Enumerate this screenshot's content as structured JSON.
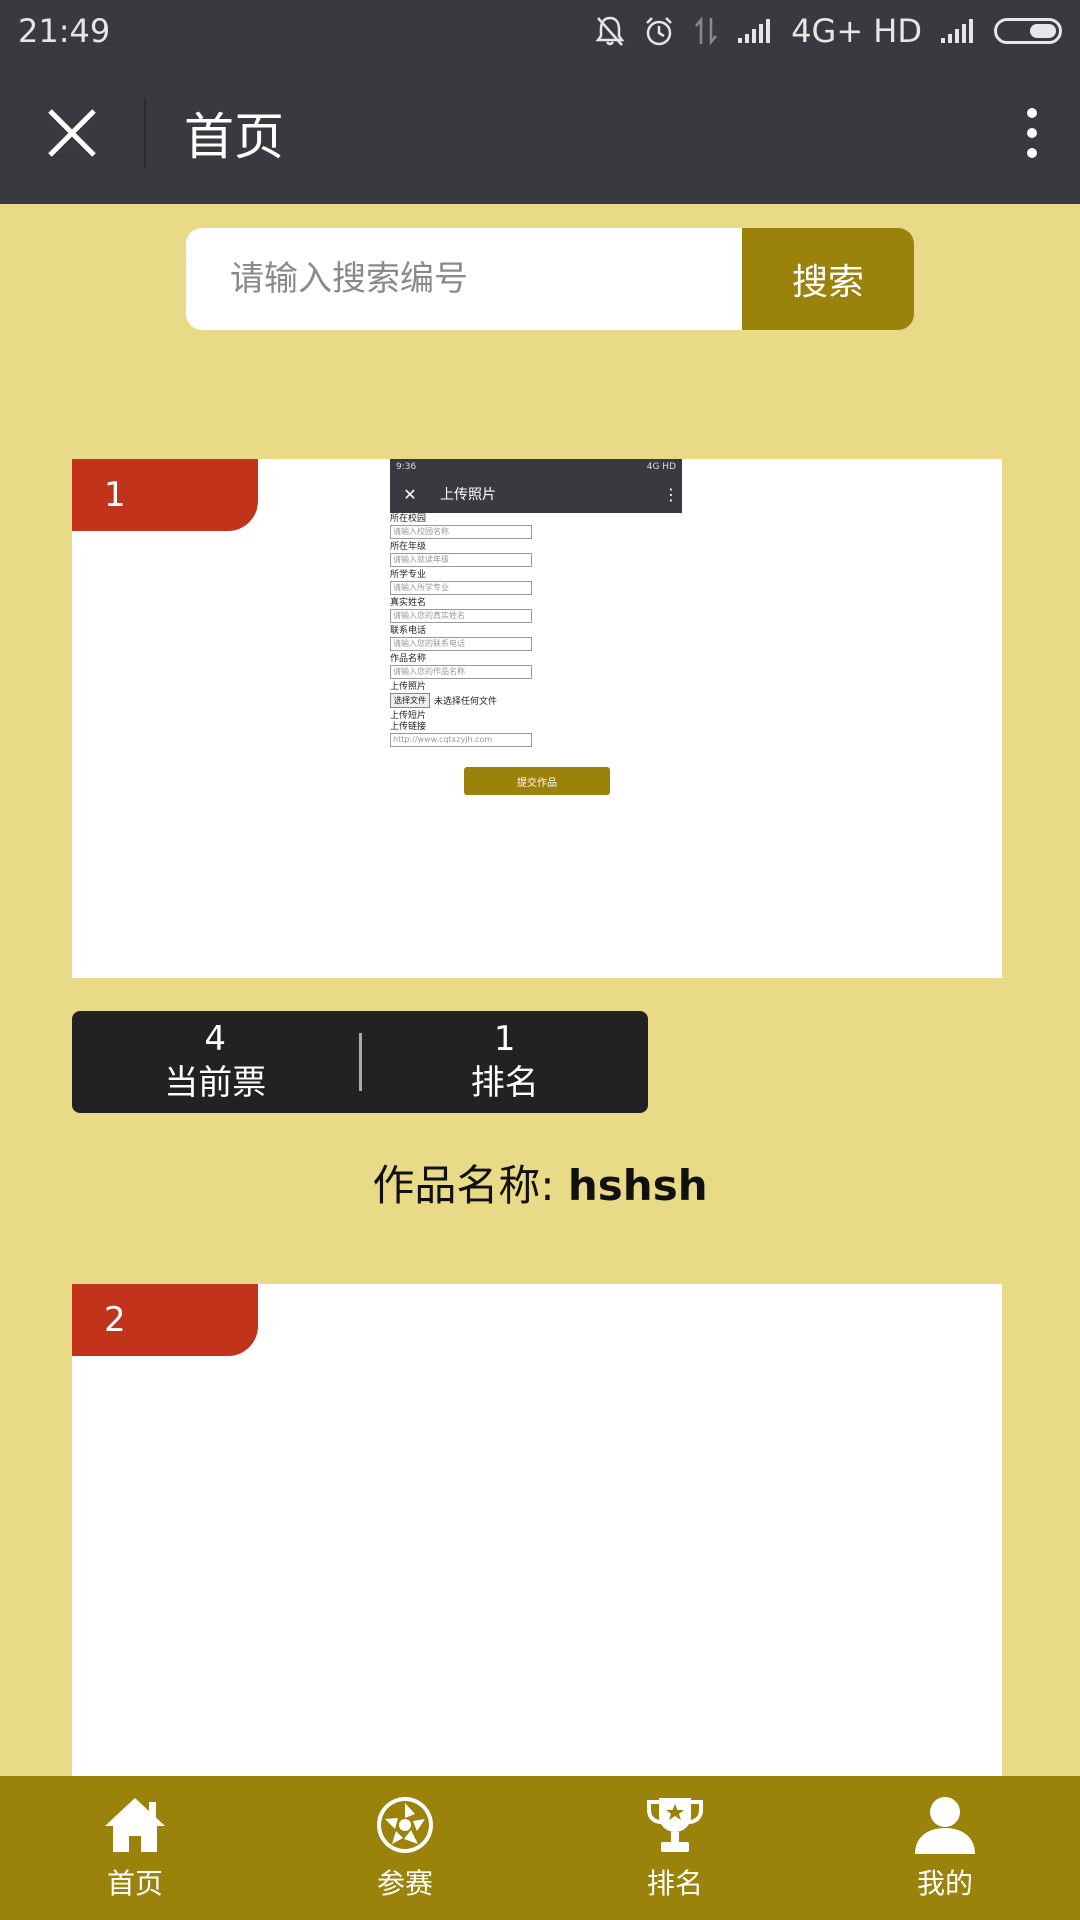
{
  "status_bar": {
    "time": "21:49",
    "network": "4G+ HD",
    "icons": [
      "bell-off-icon",
      "alarm-icon",
      "data-arrows-icon",
      "signal-icon",
      "signal-icon",
      "battery-icon"
    ]
  },
  "nav": {
    "title": "首页",
    "icons": [
      "close-icon",
      "more-vertical-icon"
    ]
  },
  "search": {
    "placeholder": "请输入搜索编号",
    "button_label": "搜索"
  },
  "entries": [
    {
      "rank": "1",
      "thumbnail": {
        "time": "9:36",
        "network": "4G HD",
        "title": "上传照片",
        "fields": [
          {
            "label": "所在校园",
            "placeholder": "请输入校园名称"
          },
          {
            "label": "所在年级",
            "placeholder": "请输入就读年级"
          },
          {
            "label": "所学专业",
            "placeholder": "请输入所学专业"
          },
          {
            "label": "真实姓名",
            "placeholder": "请输入您的真实姓名"
          },
          {
            "label": "联系电话",
            "placeholder": "请输入您的联系电话"
          },
          {
            "label": "作品名称",
            "placeholder": "请输入您的作品名称"
          }
        ],
        "upload_photo_label": "上传照片",
        "choose_file": "选择文件",
        "no_file": "未选择任何文件",
        "upload_video_label": "上传短片",
        "upload_link_label": "上传链接",
        "link_placeholder": "http://www.cqtxzyjh.com",
        "submit": "提交作品"
      },
      "votes": "4",
      "votes_label": "当前票",
      "ranking": "1",
      "ranking_label": "排名",
      "work_name_label": "作品名称: ",
      "work_name": "hshsh"
    },
    {
      "rank": "2"
    }
  ],
  "tabbar": {
    "items": [
      {
        "label": "首页",
        "icon": "home-icon"
      },
      {
        "label": "参赛",
        "icon": "aperture-icon"
      },
      {
        "label": "排名",
        "icon": "trophy-icon"
      },
      {
        "label": "我的",
        "icon": "user-icon"
      }
    ]
  },
  "colors": {
    "background": "#e9da88",
    "header": "#393a3f",
    "accent": "#9b820a",
    "rank_tag": "#c1331b",
    "vote_bar": "#222124"
  }
}
